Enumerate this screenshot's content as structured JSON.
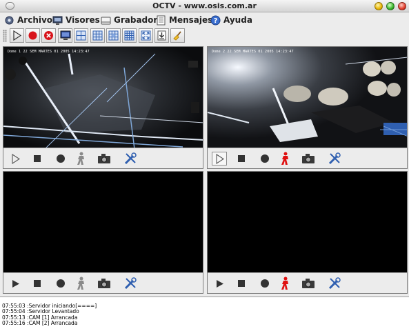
{
  "window": {
    "title": "OCTV - www.osis.com.ar"
  },
  "menu": {
    "items": [
      {
        "label": "Archivo",
        "icon": "gear-icon"
      },
      {
        "label": "Visores",
        "icon": "monitor-icon"
      },
      {
        "label": "Grabador",
        "icon": "recorder-icon"
      },
      {
        "label": "Mensajes",
        "icon": "document-icon"
      },
      {
        "label": "Ayuda",
        "icon": "help-icon"
      }
    ]
  },
  "toolbar": {
    "buttons": [
      "play-icon",
      "record-icon",
      "stop-icon",
      "monitor-icon",
      "grid-2x2-icon",
      "grid-3x3-icon",
      "grid-3x3-alt-icon",
      "grid-4x4-icon",
      "fullscreen-icon",
      "download-icon",
      "broom-icon"
    ]
  },
  "viewers": [
    {
      "id": "cam-1",
      "active": true,
      "osd": "Dome 1 22 SEM MARTES 01 2005 14:23:47"
    },
    {
      "id": "cam-2",
      "active": true,
      "osd": "Dome 2 22 SEM MARTES 01 2005 14:23:47"
    },
    {
      "id": "cam-3",
      "active": false
    },
    {
      "id": "cam-4",
      "active": false
    }
  ],
  "colors": {
    "person_active": "#e01010",
    "person_inactive": "#8a8a8a",
    "record_red": "#d8141b"
  },
  "log": {
    "lines": [
      "07:55:03 :Servidor iniciando[====]",
      "07:55:04 :Servidor Levantado",
      "07:55:13 :CAM [1] Arrancada",
      "07:55:16 :CAM [2] Arrancada"
    ]
  }
}
